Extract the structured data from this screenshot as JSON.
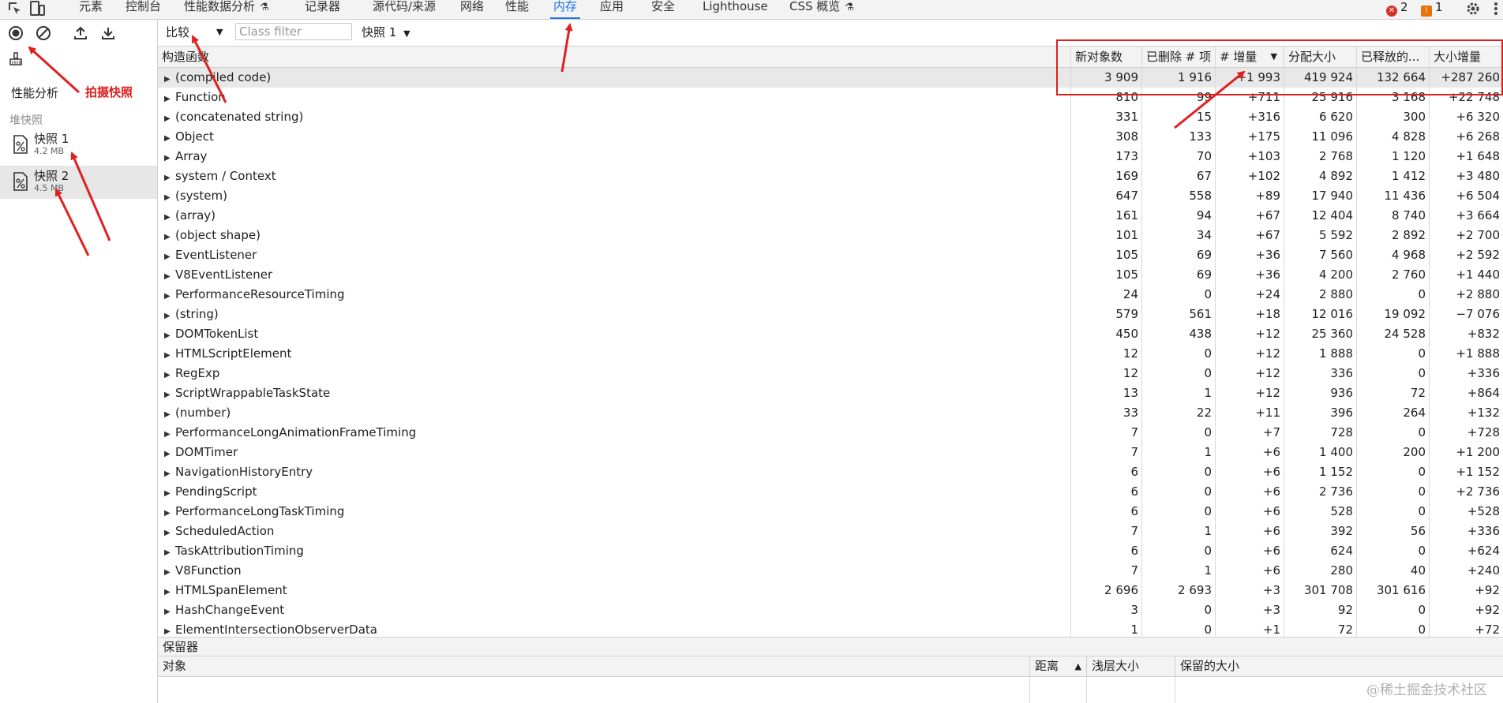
{
  "tabs": [
    {
      "label": "元素"
    },
    {
      "label": "控制台"
    },
    {
      "label": "性能数据分析",
      "flask": true
    },
    {
      "label": "记录器"
    },
    {
      "label": "源代码/来源"
    },
    {
      "label": "网络"
    },
    {
      "label": "性能"
    },
    {
      "label": "内存",
      "active": true
    },
    {
      "label": "应用"
    },
    {
      "label": "安全"
    },
    {
      "label": "Lighthouse"
    },
    {
      "label": "CSS 概览",
      "flask": true
    }
  ],
  "status": {
    "errors": "2",
    "warnings": "1"
  },
  "sidebar": {
    "title": "性能分析",
    "section": "堆快照",
    "snapshots": [
      {
        "name": "快照 1",
        "size": "4.2 MB"
      },
      {
        "name": "快照 2",
        "size": "4.5 MB",
        "selected": true
      }
    ]
  },
  "toolbar": {
    "view": "比较",
    "class_filter_placeholder": "Class filter",
    "base": "快照 1"
  },
  "grid": {
    "headers": [
      "构造函数",
      "新对象数",
      "已删除 # 项",
      "# 增量",
      "分配大小",
      "已释放的...",
      "大小增量"
    ],
    "rows": [
      [
        "(compiled code)",
        "3 909",
        "1 916",
        "+1 993",
        "419 924",
        "132 664",
        "+287 260"
      ],
      [
        "Function",
        "810",
        "99",
        "+711",
        "25 916",
        "3 168",
        "+22 748"
      ],
      [
        "(concatenated string)",
        "331",
        "15",
        "+316",
        "6 620",
        "300",
        "+6 320"
      ],
      [
        "Object",
        "308",
        "133",
        "+175",
        "11 096",
        "4 828",
        "+6 268"
      ],
      [
        "Array",
        "173",
        "70",
        "+103",
        "2 768",
        "1 120",
        "+1 648"
      ],
      [
        "system / Context",
        "169",
        "67",
        "+102",
        "4 892",
        "1 412",
        "+3 480"
      ],
      [
        "(system)",
        "647",
        "558",
        "+89",
        "17 940",
        "11 436",
        "+6 504"
      ],
      [
        "(array)",
        "161",
        "94",
        "+67",
        "12 404",
        "8 740",
        "+3 664"
      ],
      [
        "(object shape)",
        "101",
        "34",
        "+67",
        "5 592",
        "2 892",
        "+2 700"
      ],
      [
        "EventListener",
        "105",
        "69",
        "+36",
        "7 560",
        "4 968",
        "+2 592"
      ],
      [
        "V8EventListener",
        "105",
        "69",
        "+36",
        "4 200",
        "2 760",
        "+1 440"
      ],
      [
        "PerformanceResourceTiming",
        "24",
        "0",
        "+24",
        "2 880",
        "0",
        "+2 880"
      ],
      [
        "(string)",
        "579",
        "561",
        "+18",
        "12 016",
        "19 092",
        "−7 076"
      ],
      [
        "DOMTokenList",
        "450",
        "438",
        "+12",
        "25 360",
        "24 528",
        "+832"
      ],
      [
        "HTMLScriptElement",
        "12",
        "0",
        "+12",
        "1 888",
        "0",
        "+1 888"
      ],
      [
        "RegExp",
        "12",
        "0",
        "+12",
        "336",
        "0",
        "+336"
      ],
      [
        "ScriptWrappableTaskState",
        "13",
        "1",
        "+12",
        "936",
        "72",
        "+864"
      ],
      [
        "(number)",
        "33",
        "22",
        "+11",
        "396",
        "264",
        "+132"
      ],
      [
        "PerformanceLongAnimationFrameTiming",
        "7",
        "0",
        "+7",
        "728",
        "0",
        "+728"
      ],
      [
        "DOMTimer",
        "7",
        "1",
        "+6",
        "1 400",
        "200",
        "+1 200"
      ],
      [
        "NavigationHistoryEntry",
        "6",
        "0",
        "+6",
        "1 152",
        "0",
        "+1 152"
      ],
      [
        "PendingScript",
        "6",
        "0",
        "+6",
        "2 736",
        "0",
        "+2 736"
      ],
      [
        "PerformanceLongTaskTiming",
        "6",
        "0",
        "+6",
        "528",
        "0",
        "+528"
      ],
      [
        "ScheduledAction",
        "7",
        "1",
        "+6",
        "392",
        "56",
        "+336"
      ],
      [
        "TaskAttributionTiming",
        "6",
        "0",
        "+6",
        "624",
        "0",
        "+624"
      ],
      [
        "V8Function",
        "7",
        "1",
        "+6",
        "280",
        "40",
        "+240"
      ],
      [
        "HTMLSpanElement",
        "2 696",
        "2 693",
        "+3",
        "301 708",
        "301 616",
        "+92"
      ],
      [
        "HashChangeEvent",
        "3",
        "0",
        "+3",
        "92",
        "0",
        "+92"
      ],
      [
        "ElementIntersectionObserverData",
        "1",
        "0",
        "+1",
        "72",
        "0",
        "+72"
      ]
    ]
  },
  "retainers": {
    "title": "保留器",
    "headers": [
      "对象",
      "距离",
      "浅层大小",
      "保留的大小"
    ]
  },
  "annotation": {
    "label": "拍摄快照",
    "color": "#e02020"
  },
  "watermark": "@稀土掘金技术社区"
}
